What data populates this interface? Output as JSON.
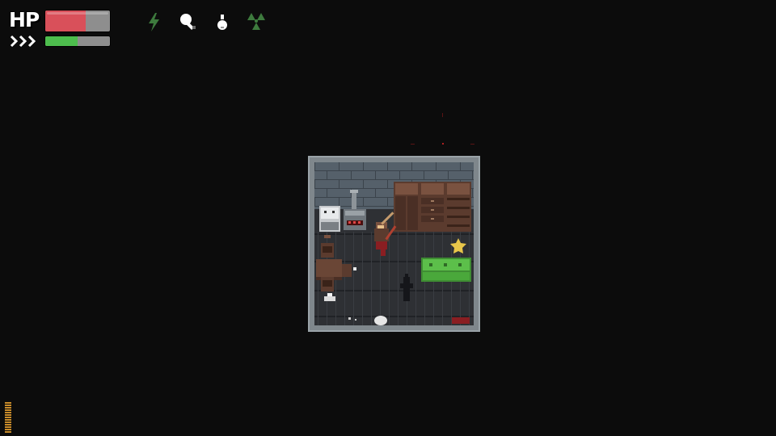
{
  "hud": {
    "hp_label": "HP",
    "hp_fraction": 0.62,
    "stamina_fraction": 0.5,
    "colors": {
      "hp_fill": "#d9505a",
      "hp_empty": "#8e8e8e",
      "stamina_fill": "#4dbd4d",
      "stamina_empty": "#8e8e8e",
      "status_icon_green": "#3d7a3d",
      "status_icon_white": "#ffffff"
    },
    "status_icons": [
      "lightning-icon",
      "bandage-icon",
      "potion-flask-icon",
      "radiation-icon"
    ],
    "stamina_icon": "sprint-chevrons-icon"
  },
  "scene": {
    "floor_color": "#2e3034",
    "wall_color": "#55606a",
    "frame_color": "#9aa3a8",
    "sofa_color": "#5cbf4a",
    "wood_color": "#5b3b2e",
    "blood_color": "#8a1e22",
    "objects": [
      "stove",
      "heater",
      "wardrobe",
      "dresser",
      "bookshelf",
      "sofa",
      "table",
      "chair",
      "player",
      "shadow-figure",
      "debris",
      "blood-puddle"
    ]
  },
  "ammo_icon": "ammo-strip-icon"
}
